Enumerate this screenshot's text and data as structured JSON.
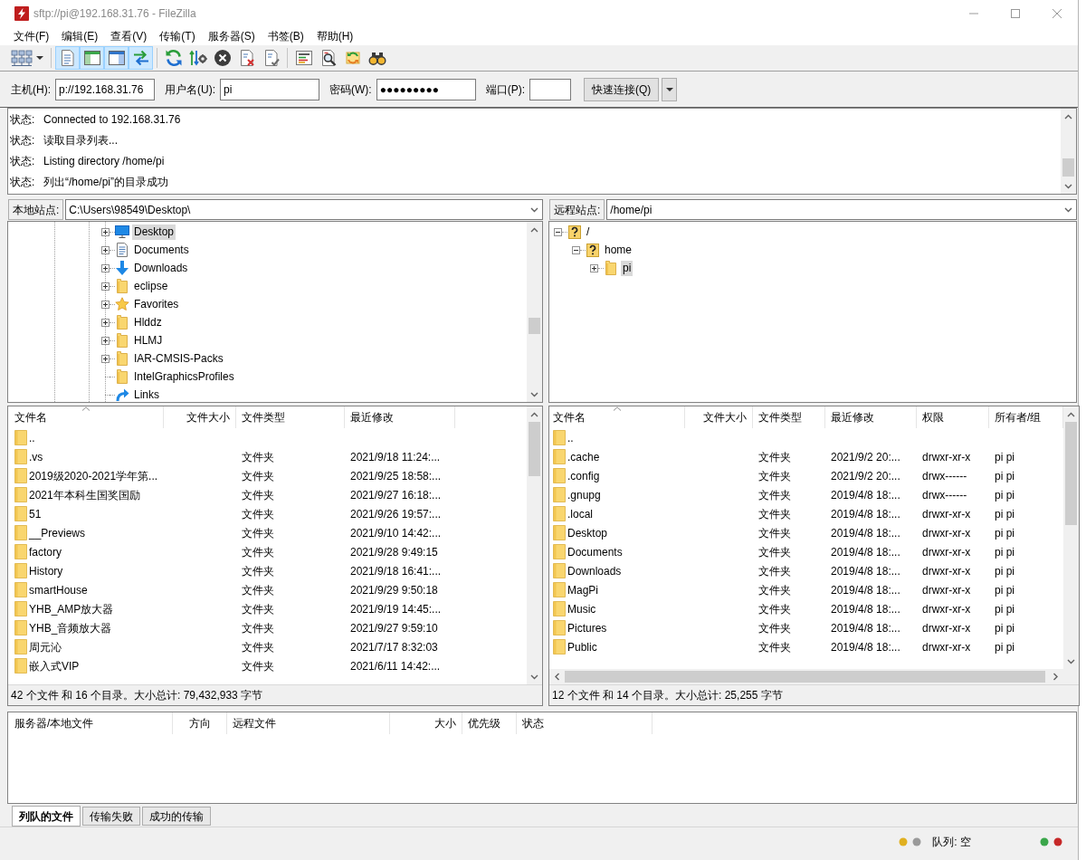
{
  "window": {
    "title": "sftp://pi@192.168.31.76 - FileZilla"
  },
  "menu": [
    "文件(F)",
    "编辑(E)",
    "查看(V)",
    "传输(T)",
    "服务器(S)",
    "书签(B)",
    "帮助(H)"
  ],
  "toolbar": [
    {
      "kind": "sitemanager"
    },
    {
      "kind": "separator"
    },
    {
      "kind": "log",
      "on": true
    },
    {
      "kind": "localtree",
      "on": true
    },
    {
      "kind": "remotetree",
      "on": true
    },
    {
      "kind": "queue",
      "on": true
    },
    {
      "kind": "separator"
    },
    {
      "kind": "refresh"
    },
    {
      "kind": "process"
    },
    {
      "kind": "cancel"
    },
    {
      "kind": "disconnect"
    },
    {
      "kind": "reconnect"
    },
    {
      "kind": "separator"
    },
    {
      "kind": "filter"
    },
    {
      "kind": "compare"
    },
    {
      "kind": "sync"
    },
    {
      "kind": "search"
    }
  ],
  "quickconnect": {
    "fields": [
      {
        "kind": "host",
        "label": "主机(H):",
        "value": "p://192.168.31.76"
      },
      {
        "kind": "username",
        "label": "用户名(U):",
        "value": "pi"
      },
      {
        "kind": "password",
        "label": "密码(W):",
        "value": "●●●●●●●●●"
      },
      {
        "kind": "port",
        "label": "端口(P):"
      }
    ],
    "button": "快速连接(Q)"
  },
  "log": [
    {
      "label": "状态:",
      "text": "Connected to 192.168.31.76"
    },
    {
      "label": "状态:",
      "text": "读取目录列表..."
    },
    {
      "label": "状态:",
      "text": "Listing directory /home/pi"
    },
    {
      "label": "状态:",
      "text": "列出“/home/pi”的目录成功"
    }
  ],
  "local": {
    "site_label": "本地站点:",
    "path": "C:\\Users\\98549\\Desktop\\",
    "tree": [
      {
        "label": "Desktop",
        "kind": "desktop",
        "expanded": false,
        "selected": true
      },
      {
        "label": "Documents",
        "kind": "documents",
        "expanded": false,
        "selected": false
      },
      {
        "label": "Downloads",
        "kind": "downloads",
        "expanded": false,
        "selected": false
      },
      {
        "label": "eclipse",
        "kind": "folder",
        "expanded": false,
        "selected": false
      },
      {
        "label": "Favorites",
        "kind": "favorites",
        "expanded": false,
        "selected": false
      },
      {
        "label": "Hlddz",
        "kind": "folder",
        "expanded": false,
        "selected": false
      },
      {
        "label": "HLMJ",
        "kind": "folder",
        "expanded": false,
        "selected": false
      },
      {
        "label": "IAR-CMSIS-Packs",
        "kind": "folder",
        "expanded": false,
        "selected": false
      },
      {
        "label": "IntelGraphicsProfiles",
        "kind": "folder",
        "selected": false
      },
      {
        "label": "Links",
        "kind": "link",
        "selected": false
      }
    ],
    "columns": [
      {
        "label": "文件名",
        "sorted": true
      },
      {
        "label": "文件大小",
        "sorted": false
      },
      {
        "label": "文件类型",
        "sorted": false
      },
      {
        "label": "最近修改",
        "sorted": false
      }
    ],
    "rows": [
      {
        "name": ".."
      },
      {
        "name": ".vs",
        "type": "文件夹",
        "modified": "2021/9/18 11:24:..."
      },
      {
        "name": "2019级2020-2021学年第...",
        "type": "文件夹",
        "modified": "2021/9/25 18:58:..."
      },
      {
        "name": "2021年本科生国奖国励",
        "type": "文件夹",
        "modified": "2021/9/27 16:18:..."
      },
      {
        "name": "51",
        "type": "文件夹",
        "modified": "2021/9/26 19:57:..."
      },
      {
        "name": "__Previews",
        "type": "文件夹",
        "modified": "2021/9/10 14:42:..."
      },
      {
        "name": "factory",
        "type": "文件夹",
        "modified": "2021/9/28 9:49:15"
      },
      {
        "name": "History",
        "type": "文件夹",
        "modified": "2021/9/18 16:41:..."
      },
      {
        "name": "smartHouse",
        "type": "文件夹",
        "modified": "2021/9/29 9:50:18"
      },
      {
        "name": "YHB_AMP放大器",
        "type": "文件夹",
        "modified": "2021/9/19 14:45:..."
      },
      {
        "name": "YHB_音频放大器",
        "type": "文件夹",
        "modified": "2021/9/27 9:59:10"
      },
      {
        "name": "周元沁",
        "type": "文件夹",
        "modified": "2021/7/17 8:32:03"
      },
      {
        "name": "嵌入式VIP",
        "type": "文件夹",
        "modified": "2021/6/11 14:42:..."
      }
    ],
    "summary": "42 个文件 和 16 个目录。大小总计: 79,432,933 字节"
  },
  "remote": {
    "site_label": "远程站点:",
    "path": "/home/pi",
    "tree": [
      {
        "label": "/",
        "kind": "unknown",
        "expanded": true,
        "selected": false,
        "children": [
          {
            "label": "home",
            "kind": "unknown",
            "expanded": true,
            "selected": false,
            "children": [
              {
                "label": "pi",
                "kind": "folder",
                "expanded": false,
                "selected": true
              }
            ]
          }
        ]
      }
    ],
    "columns": [
      {
        "label": "文件名",
        "sorted": true
      },
      {
        "label": "文件大小",
        "sorted": false
      },
      {
        "label": "文件类型",
        "sorted": false
      },
      {
        "label": "最近修改",
        "sorted": false
      },
      {
        "label": "权限",
        "sorted": false
      },
      {
        "label": "所有者/组",
        "sorted": false
      }
    ],
    "rows": [
      {
        "name": ".."
      },
      {
        "name": ".cache",
        "type": "文件夹",
        "modified": "2021/9/2 20:...",
        "permissions": "drwxr-xr-x",
        "owner": "pi pi"
      },
      {
        "name": ".config",
        "type": "文件夹",
        "modified": "2021/9/2 20:...",
        "permissions": "drwx------",
        "owner": "pi pi"
      },
      {
        "name": ".gnupg",
        "type": "文件夹",
        "modified": "2019/4/8 18:...",
        "permissions": "drwx------",
        "owner": "pi pi"
      },
      {
        "name": ".local",
        "type": "文件夹",
        "modified": "2019/4/8 18:...",
        "permissions": "drwxr-xr-x",
        "owner": "pi pi"
      },
      {
        "name": "Desktop",
        "type": "文件夹",
        "modified": "2019/4/8 18:...",
        "permissions": "drwxr-xr-x",
        "owner": "pi pi"
      },
      {
        "name": "Documents",
        "type": "文件夹",
        "modified": "2019/4/8 18:...",
        "permissions": "drwxr-xr-x",
        "owner": "pi pi"
      },
      {
        "name": "Downloads",
        "type": "文件夹",
        "modified": "2019/4/8 18:...",
        "permissions": "drwxr-xr-x",
        "owner": "pi pi"
      },
      {
        "name": "MagPi",
        "type": "文件夹",
        "modified": "2019/4/8 18:...",
        "permissions": "drwxr-xr-x",
        "owner": "pi pi"
      },
      {
        "name": "Music",
        "type": "文件夹",
        "modified": "2019/4/8 18:...",
        "permissions": "drwxr-xr-x",
        "owner": "pi pi"
      },
      {
        "name": "Pictures",
        "type": "文件夹",
        "modified": "2019/4/8 18:...",
        "permissions": "drwxr-xr-x",
        "owner": "pi pi"
      },
      {
        "name": "Public",
        "type": "文件夹",
        "modified": "2019/4/8 18:...",
        "permissions": "drwxr-xr-x",
        "owner": "pi pi"
      }
    ],
    "summary": "12 个文件 和 14 个目录。大小总计: 25,255 字节"
  },
  "queue": {
    "columns": [
      "服务器/本地文件",
      "方向",
      "远程文件",
      "大小",
      "优先级",
      "状态"
    ],
    "tabs": [
      {
        "label": "列队的文件",
        "selected": true
      },
      {
        "label": "传输失败",
        "selected": false
      },
      {
        "label": "成功的传输",
        "selected": false
      }
    ]
  },
  "status_bar": {
    "queue": "队列: 空"
  }
}
